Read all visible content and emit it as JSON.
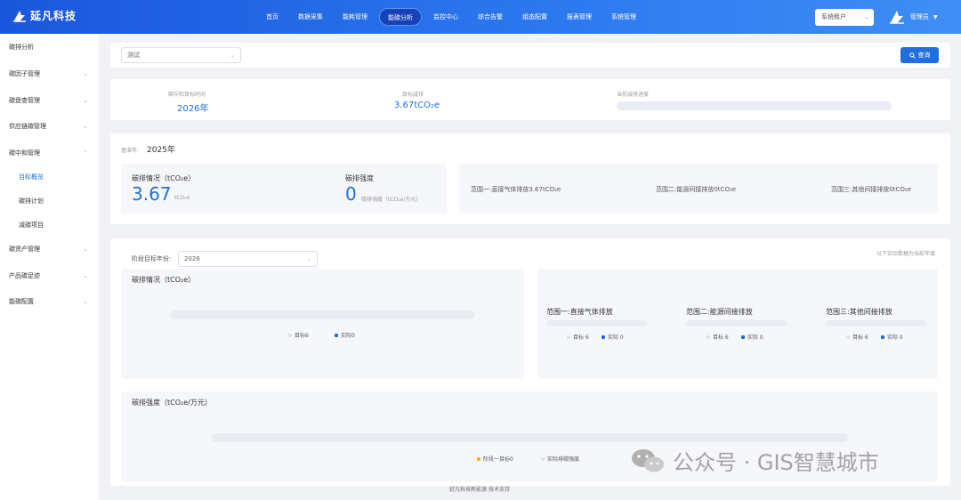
{
  "app": {
    "brand": "延凡科技"
  },
  "nav": [
    "首页",
    "数据采集",
    "能耗管理",
    "能碳分析",
    "监控中心",
    "综合告警",
    "组态配置",
    "报表管理",
    "系统管理"
  ],
  "header": {
    "tenant": "系统租户",
    "user": "管理员"
  },
  "sidebar": {
    "items": [
      "碳排分析",
      "碳因子管理",
      "碳盘查管理",
      "供应链碳管理",
      "碳中和管理",
      "碳资产管理",
      "产品碳足迹",
      "能碳配置"
    ],
    "sub": [
      "目标概览",
      "碳排计划",
      "减碳项目"
    ]
  },
  "filter": {
    "value": "测试",
    "query_label": "查询"
  },
  "summary": {
    "neutral_time_label": "碳中和目标时间",
    "neutral_time_value": "2026年",
    "target_reduction_label": "目标减排",
    "target_reduction_value": "3.67tCO₂e",
    "progress_label": "当前减排进度",
    "progress_value": 0
  },
  "baseline": {
    "year_label": "基准年:",
    "year_value": "2025年",
    "emission_title": "碳排情况（tCO₂e）",
    "emission_value": "3.67",
    "emission_unit": "tCO₂e",
    "intensity_title": "碳排强度",
    "intensity_value": "0",
    "intensity_unit": "碳排强度（tCO₂e/万元）",
    "scope1": "范围一:直接气体排放3.67tCO₂e",
    "scope2": "范围二:能源间接排放0tCO₂e",
    "scope3": "范围三:其他间接排放0tCO₂e"
  },
  "stage": {
    "year_label": "阶段目标年份:",
    "year_value": "2026",
    "note": "以下实际数据为当前年度",
    "emission_title": "碳排情况（tCO₂e）",
    "target_legend": "目标6",
    "actual_legend": "实际0",
    "scopes": [
      {
        "title": "范围一:直接气体排放",
        "target": "目标 6",
        "actual": "实际 0",
        "target_value": 6,
        "actual_value": 0
      },
      {
        "title": "范围二:能源间接排放",
        "target": "目标 6",
        "actual": "实际 0",
        "target_value": 6,
        "actual_value": 0
      },
      {
        "title": "范围三:其他间接排放",
        "target": "目标 6",
        "actual": "实际 0",
        "target_value": 6,
        "actual_value": 0
      }
    ],
    "intensity_title": "碳排强度（tCO₂e/万元）",
    "intensity_target_legend": "阶段一目标0",
    "intensity_actual_legend": "实际排碳强度"
  },
  "colors": {
    "primary": "#1f6fe0",
    "topbar": "#2d7af0",
    "legend_actual": "#1f6fe0",
    "legend_target_gold": "#f0b400"
  },
  "footer": "延凡科技新能源 技术支持",
  "watermark": "公众号 · GIS智慧城市"
}
